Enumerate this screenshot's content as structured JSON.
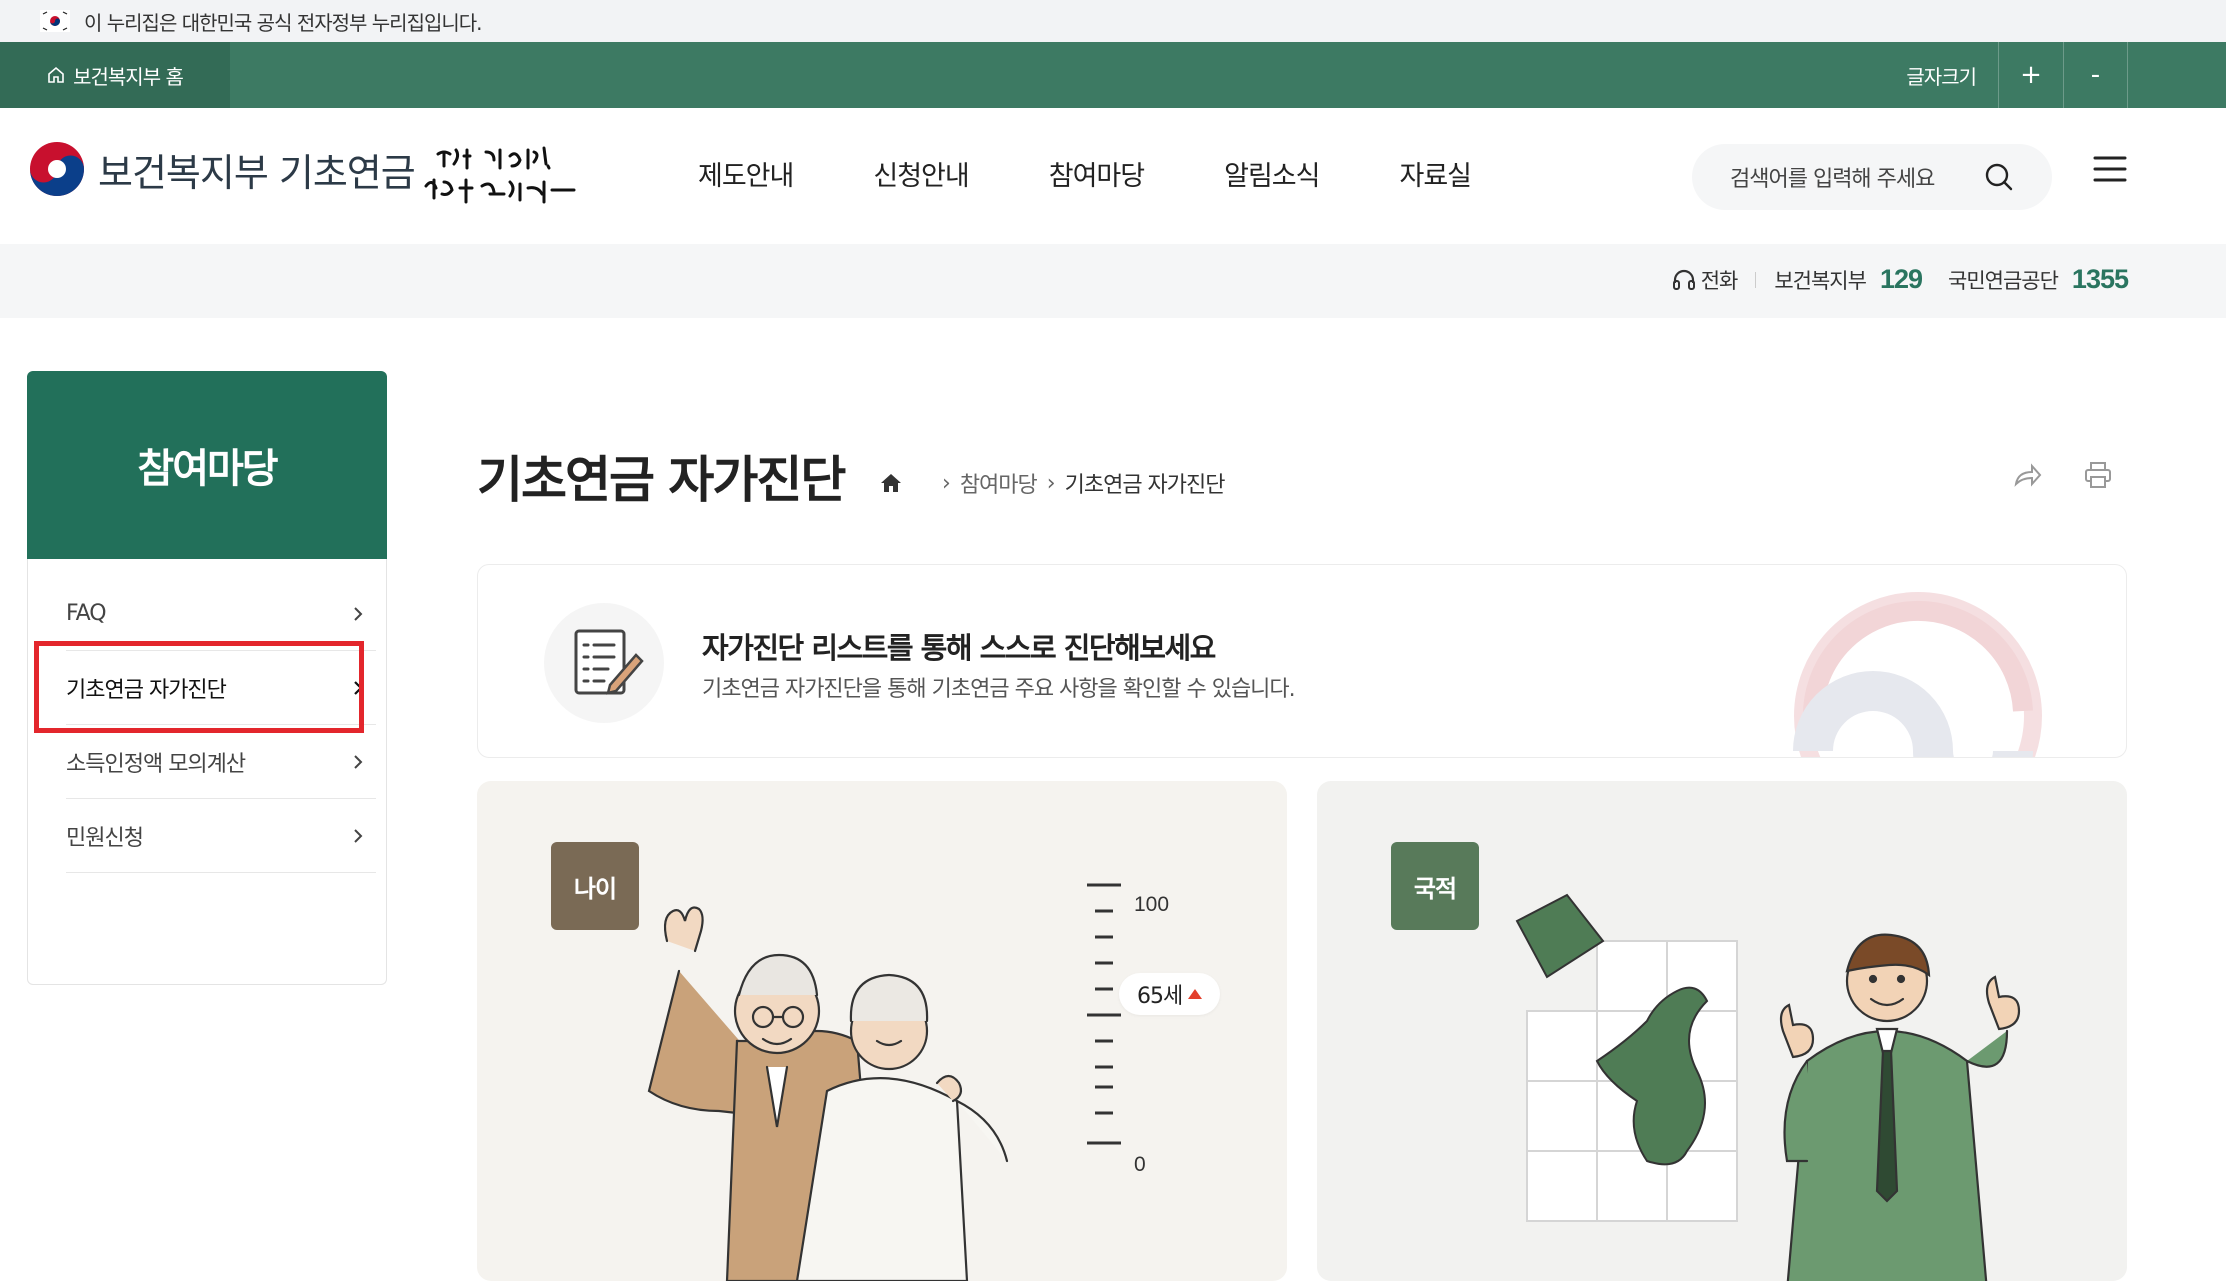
{
  "gov_banner": {
    "text": "이 누리집은 대한민국 공식 전자정부 누리집입니다."
  },
  "util_bar": {
    "home_label": "보건복지부 홈",
    "font_size_label": "글자크기",
    "increase_label": "+",
    "decrease_label": "-"
  },
  "header": {
    "logo_text": "보건복지부 기초연금",
    "nav": [
      "제도안내",
      "신청안내",
      "참여마당",
      "알림소식",
      "자료실"
    ],
    "search_placeholder": "검색어를 입력해 주세요"
  },
  "phone": {
    "label": "전화",
    "org1": "보건복지부",
    "num1": "129",
    "org2": "국민연금공단",
    "num2": "1355"
  },
  "sidebar": {
    "title": "참여마당",
    "items": [
      {
        "label": "FAQ"
      },
      {
        "label": "기초연금 자가진단"
      },
      {
        "label": "소득인정액 모의계산"
      },
      {
        "label": "민원신청"
      }
    ]
  },
  "content": {
    "title": "기초연금 자가진단",
    "breadcrumb": [
      "참여마당",
      "기초연금 자가진단"
    ],
    "intro_title": "자가진단 리스트를 통해 스스로 진단해보세요",
    "intro_desc": "기초연금 자가진단을 통해 기초연금 주요 사항을 확인할 수 있습니다.",
    "card_age": {
      "tag": "나이",
      "scale_top": "100",
      "scale_marker": "65세",
      "scale_bottom": "0"
    },
    "card_nation": {
      "tag": "국적"
    }
  },
  "colors": {
    "primary_green": "#3d7a63",
    "sidebar_green": "#22705a",
    "highlight_red": "#e3262c"
  }
}
